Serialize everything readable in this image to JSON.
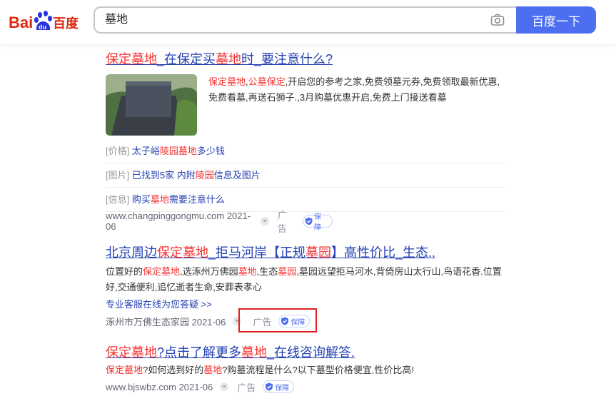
{
  "header": {
    "logo_text": "Bai百度",
    "search_value": "墓地",
    "search_button": "百度一下"
  },
  "results": [
    {
      "title_parts": [
        "保定墓地",
        "_在保定买",
        "墓地",
        "时_要注意什么?"
      ],
      "desc_parts": [
        "保定墓地",
        ",",
        "公墓保定",
        ",开启您的参考之家,免费领墓元券,免费领取最新优惠,",
        "免费看墓,再送石狮子.,3月购墓优惠开启,免费上门接送看墓"
      ],
      "sub_rows": [
        {
          "tag": "[价格]",
          "parts": [
            "太子峪",
            "陵园墓地",
            "多少钱"
          ]
        },
        {
          "tag": "[图片]",
          "parts": [
            "已找到5家 内附",
            "陵园",
            "信息及图片"
          ]
        },
        {
          "tag": "[信息]",
          "parts": [
            "购买",
            "墓地",
            "需要注意什么"
          ]
        }
      ],
      "source": "www.changpinggongmu.com 2021-06",
      "ad": "广告",
      "badge": "保障"
    },
    {
      "title_parts": [
        "北京周边",
        "保定墓地",
        "_拒马河岸【正规",
        "墓园",
        "】高性价比_生态.."
      ],
      "desc_line1_parts": [
        "位置好的",
        "保定墓地",
        ",选涿州万佛园",
        "墓地",
        ",生态",
        "墓园",
        ",墓园远望拒马河水,背倚房山太行山,鸟语花香.位置"
      ],
      "desc_line2": "好,交通便利,追忆逝者生命,安葬表孝心",
      "link": "专业客服在线为您答疑 >>",
      "source": "涿州市万佛生态家园 2021-06",
      "ad": "广告",
      "badge": "保障"
    },
    {
      "title_parts": [
        "保定墓地",
        "?点击了解更多",
        "墓地",
        "_在线咨询解答."
      ],
      "desc_parts": [
        "保定墓地",
        "?如何选到好的",
        "墓地",
        "?购墓流程是什么?以下墓型价格便宜,性价比高!"
      ],
      "source": "www.bjswbz.com 2021-06",
      "ad": "广告",
      "badge": "保障"
    }
  ],
  "colors": {
    "accent": "#4e6ef2",
    "link": "#2440b3",
    "highlight": "#f73131",
    "box": "#e02020"
  }
}
